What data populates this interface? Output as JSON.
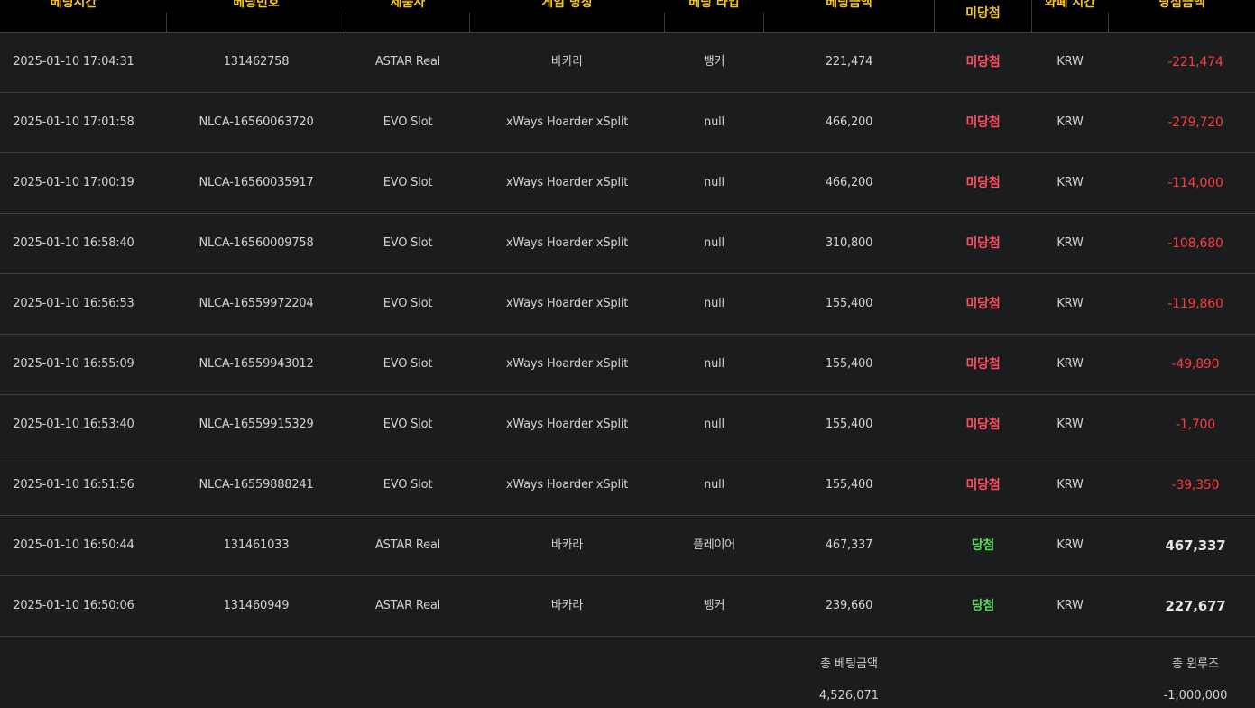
{
  "header": {
    "bet_time": "베팅시간",
    "bet_id": "베팅번호",
    "provider": "제품사",
    "game_name": "게임 명칭",
    "bet_type": "베팅 타입",
    "bet_amount": "베팅금액",
    "result": "미당첨",
    "currency": "화폐 시간",
    "win_amount": "당첨금액"
  },
  "rows": [
    {
      "time": "2025-01-10 17:04:31",
      "id": "131462758",
      "provider": "ASTAR Real",
      "game": "바카라",
      "type": "뱅커",
      "amount": "221,474",
      "status": "미당첨",
      "status_kind": "lose",
      "currency": "KRW",
      "win": "-221,474"
    },
    {
      "time": "2025-01-10 17:01:58",
      "id": "NLCA-16560063720",
      "provider": "EVO Slot",
      "game": "xWays Hoarder xSplit",
      "type": "null",
      "amount": "466,200",
      "status": "미당첨",
      "status_kind": "lose",
      "currency": "KRW",
      "win": "-279,720"
    },
    {
      "time": "2025-01-10 17:00:19",
      "id": "NLCA-16560035917",
      "provider": "EVO Slot",
      "game": "xWays Hoarder xSplit",
      "type": "null",
      "amount": "466,200",
      "status": "미당첨",
      "status_kind": "lose",
      "currency": "KRW",
      "win": "-114,000"
    },
    {
      "time": "2025-01-10 16:58:40",
      "id": "NLCA-16560009758",
      "provider": "EVO Slot",
      "game": "xWays Hoarder xSplit",
      "type": "null",
      "amount": "310,800",
      "status": "미당첨",
      "status_kind": "lose",
      "currency": "KRW",
      "win": "-108,680"
    },
    {
      "time": "2025-01-10 16:56:53",
      "id": "NLCA-16559972204",
      "provider": "EVO Slot",
      "game": "xWays Hoarder xSplit",
      "type": "null",
      "amount": "155,400",
      "status": "미당첨",
      "status_kind": "lose",
      "currency": "KRW",
      "win": "-119,860"
    },
    {
      "time": "2025-01-10 16:55:09",
      "id": "NLCA-16559943012",
      "provider": "EVO Slot",
      "game": "xWays Hoarder xSplit",
      "type": "null",
      "amount": "155,400",
      "status": "미당첨",
      "status_kind": "lose",
      "currency": "KRW",
      "win": "-49,890"
    },
    {
      "time": "2025-01-10 16:53:40",
      "id": "NLCA-16559915329",
      "provider": "EVO Slot",
      "game": "xWays Hoarder xSplit",
      "type": "null",
      "amount": "155,400",
      "status": "미당첨",
      "status_kind": "lose",
      "currency": "KRW",
      "win": "-1,700"
    },
    {
      "time": "2025-01-10 16:51:56",
      "id": "NLCA-16559888241",
      "provider": "EVO Slot",
      "game": "xWays Hoarder xSplit",
      "type": "null",
      "amount": "155,400",
      "status": "미당첨",
      "status_kind": "lose",
      "currency": "KRW",
      "win": "-39,350"
    },
    {
      "time": "2025-01-10 16:50:44",
      "id": "131461033",
      "provider": "ASTAR Real",
      "game": "바카라",
      "type": "플레이어",
      "amount": "467,337",
      "status": "당첨",
      "status_kind": "win",
      "currency": "KRW",
      "win": "467,337"
    },
    {
      "time": "2025-01-10 16:50:06",
      "id": "131460949",
      "provider": "ASTAR Real",
      "game": "바카라",
      "type": "뱅커",
      "amount": "239,660",
      "status": "당첨",
      "status_kind": "win",
      "currency": "KRW",
      "win": "227,677"
    }
  ],
  "footer": {
    "total_bet_label": "총 베팅금액",
    "total_bet_value": "4,526,071",
    "total_winloss_label": "총 윈루즈",
    "total_winloss_value": "-1,000,000"
  },
  "colors": {
    "header_text": "#f5c518",
    "lose": "#ff4d5e",
    "win": "#5ad65a",
    "negative_amount": "#ff3b3b",
    "background": "#1b1c1e"
  }
}
